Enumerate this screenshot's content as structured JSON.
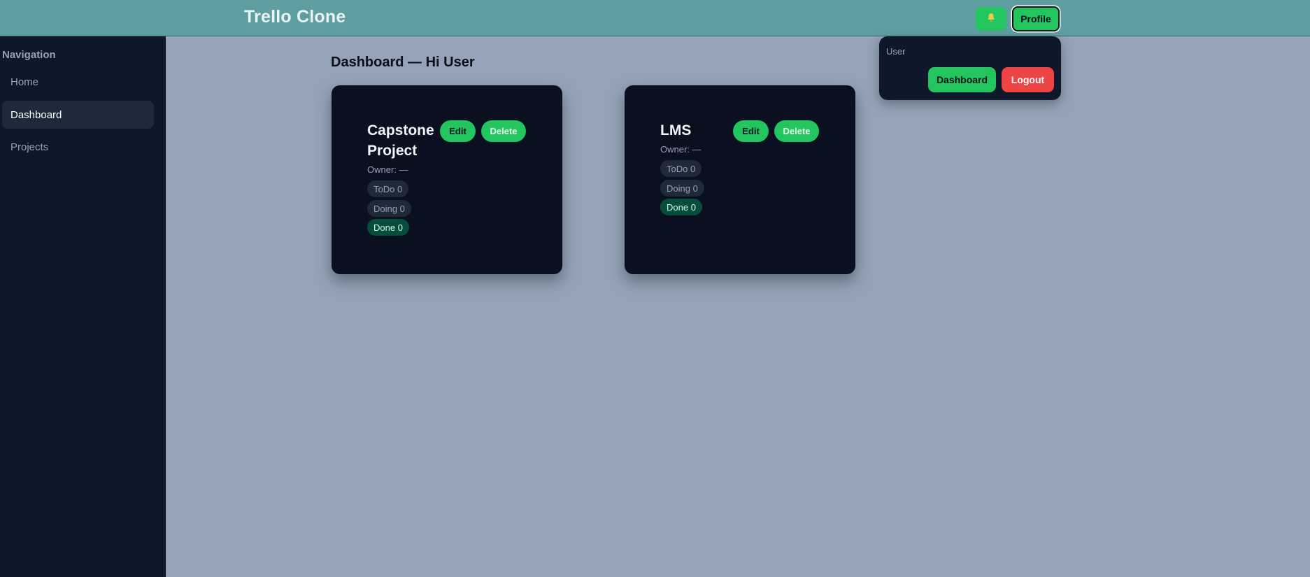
{
  "app": {
    "title": "Trello Clone"
  },
  "header": {
    "notification_icon": "bell-icon",
    "profile_label": "Profile"
  },
  "profile_menu": {
    "user_label": "User",
    "dashboard_label": "Dashboard",
    "logout_label": "Logout"
  },
  "sidebar": {
    "heading": "Navigation",
    "items": [
      {
        "label": "Home",
        "active": false
      },
      {
        "label": "Dashboard",
        "active": true
      },
      {
        "label": "Projects",
        "active": false
      }
    ]
  },
  "main": {
    "title": "Dashboard — Hi User",
    "projects": [
      {
        "name": "Capstone Project",
        "owner": "Owner: —",
        "edit_label": "Edit",
        "delete_label": "Delete",
        "counts": [
          "ToDo 0",
          "Doing 0",
          "Done 0"
        ]
      },
      {
        "name": "LMS",
        "owner": "Owner: —",
        "edit_label": "Edit",
        "delete_label": "Delete",
        "counts": [
          "ToDo 0",
          "Doing 0",
          "Done 0"
        ]
      }
    ]
  },
  "colors": {
    "header_bg": "#5f9ea0",
    "sidebar_bg": "#0f172a",
    "page_bg": "#94a3b8",
    "card_bg": "#0b1020",
    "accent_green": "#22c55e",
    "danger_red": "#ef4444"
  }
}
